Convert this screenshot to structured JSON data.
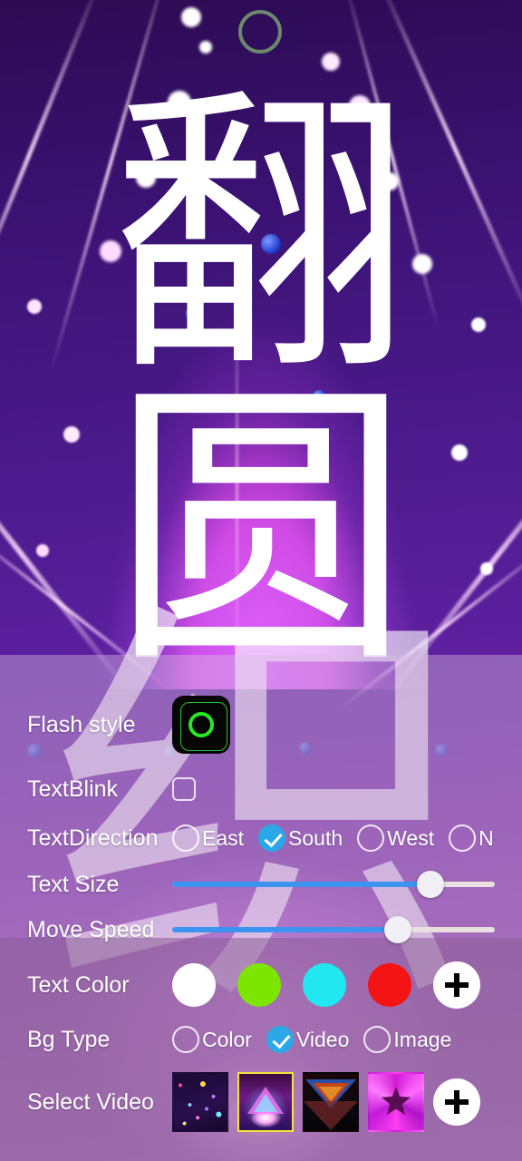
{
  "preview": {
    "text_lines": [
      "翻",
      "圆"
    ],
    "flash_indicator": "green-ring",
    "watermark_text": "织"
  },
  "panel": {
    "flash_style": {
      "label": "Flash style",
      "thumbnail_name": "green-ring-flash-thumbnail"
    },
    "text_blink": {
      "label": "TextBlink",
      "checked": false
    },
    "text_direction": {
      "label": "TextDirection",
      "options": [
        "East",
        "South",
        "West",
        "N"
      ],
      "selected": "South"
    },
    "text_size": {
      "label": "Text Size",
      "value": 80,
      "min": 0,
      "max": 100
    },
    "move_speed": {
      "label": "Move Speed",
      "value": 70,
      "min": 0,
      "max": 100
    },
    "text_color": {
      "label": "Text Color",
      "swatches": [
        "#ffffff",
        "#7ce600",
        "#21e8f0",
        "#f51414"
      ],
      "add_label": "+"
    },
    "bg_type": {
      "label": "Bg Type",
      "options": [
        "Color",
        "Video",
        "Image"
      ],
      "selected": "Video"
    },
    "select_video": {
      "label": "Select Video",
      "thumbnails": [
        "confetti-particles",
        "neon-triangle-tunnel",
        "nested-triangles-dark",
        "magenta-kaleidoscope-star"
      ],
      "selected_index": 1,
      "add_label": "+"
    }
  },
  "colors": {
    "accent_blue": "#2aa8e8",
    "slider_fill": "#3b94f0",
    "slider_track": "#e8e0e0",
    "selected_border": "#f5e23a",
    "flash_green": "#25e825",
    "panel_upper": "rgba(214,188,224,0.42)",
    "panel_lower": "rgba(138,95,150,0.55)"
  }
}
